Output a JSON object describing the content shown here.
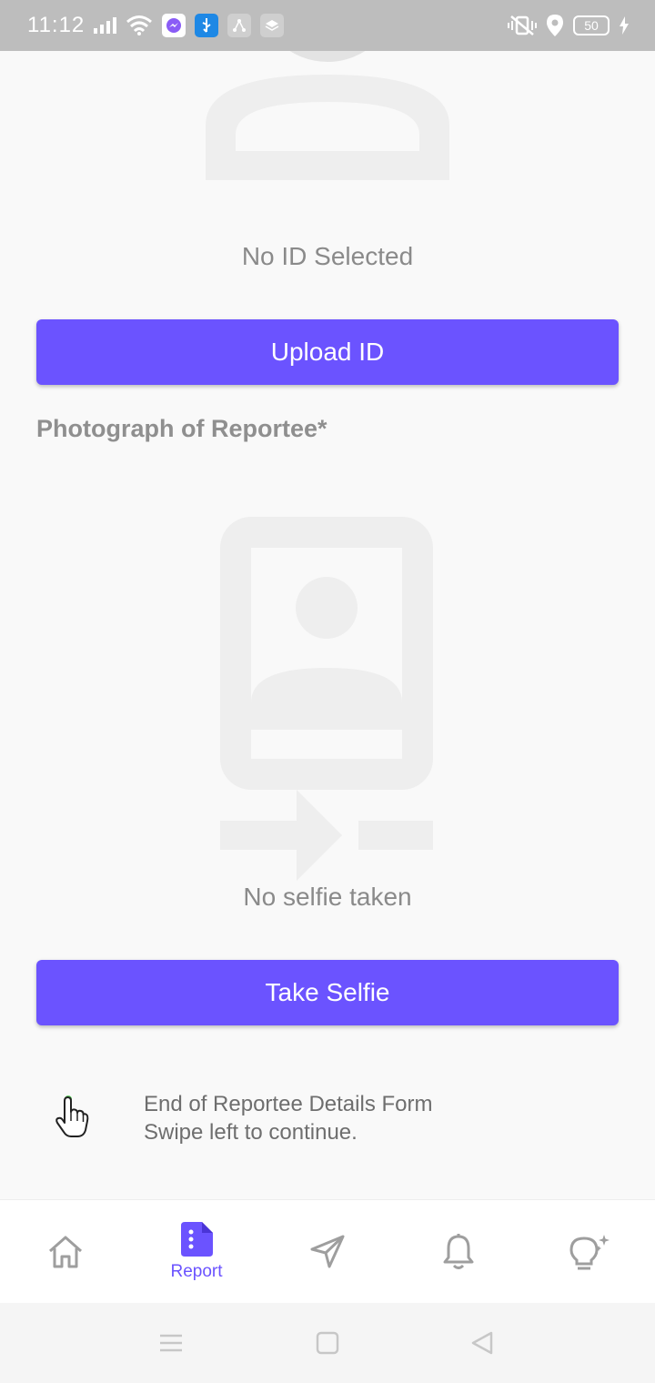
{
  "status_bar": {
    "time": "11:12",
    "battery": "50"
  },
  "id_section": {
    "status_text": "No ID Selected",
    "upload_button": "Upload ID"
  },
  "photo_section": {
    "label": "Photograph of Reportee*",
    "status_text": "No selfie taken",
    "take_button": "Take Selfie"
  },
  "hint": {
    "line1": "End of Reportee Details Form",
    "line2": "Swipe left to continue."
  },
  "bottom_nav": {
    "items": [
      {
        "name": "home",
        "label": "",
        "icon": "home-icon"
      },
      {
        "name": "report",
        "label": "Report",
        "icon": "report-icon",
        "active": true
      },
      {
        "name": "send",
        "label": "",
        "icon": "send-icon"
      },
      {
        "name": "notifications",
        "label": "",
        "icon": "bell-icon"
      },
      {
        "name": "tips",
        "label": "",
        "icon": "lightbulb-icon"
      }
    ]
  },
  "colors": {
    "accent": "#6b53ff",
    "status_bar": "#bdbdbd",
    "illustration": "#eeeeee"
  }
}
